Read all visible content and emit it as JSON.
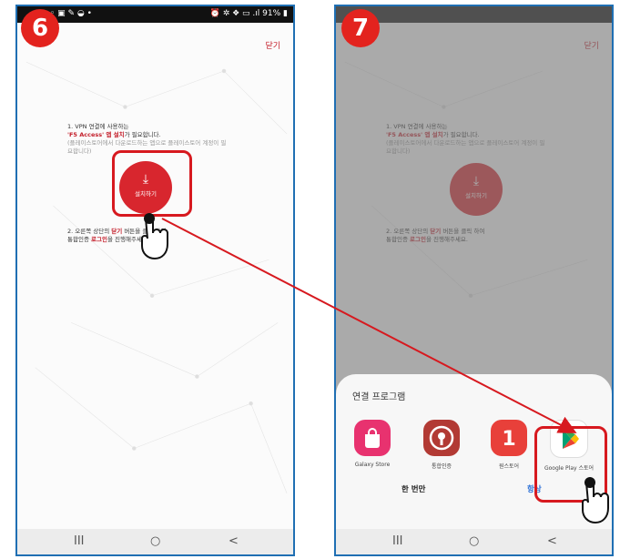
{
  "steps": {
    "left_number": "6",
    "right_number": "7"
  },
  "status_bar": {
    "battery": "91%"
  },
  "screen": {
    "close_label": "닫기",
    "step1_line1": "1. VPN 연결에 사용하는",
    "step1_app": "'F5 Access' 앱 설치",
    "step1_line2_suffix": "가 필요합니다.",
    "step1_note_line1": "(플레이스토어에서 다운로드하는 앱으로 플레이스토어 계정이 필",
    "step1_note_line2": "요합니다)",
    "install_label": "설치하기",
    "step2_prefix": "2. 오른쪽 상단의 ",
    "step2_close": "닫기",
    "step2_suffix": " 버튼을 클릭 하여",
    "step2_line2_prefix": "통합인증 ",
    "step2_login": "로그인",
    "step2_line2_suffix": "을 진행해주세요."
  },
  "sheet": {
    "title": "연결 프로그램",
    "apps": [
      {
        "label": "Galaxy Store",
        "icon": "galaxy-store-icon",
        "color": "#e8326f"
      },
      {
        "label": "통합인증",
        "icon": "auth-icon",
        "color": "#b23a34"
      },
      {
        "label": "원스토어",
        "icon": "onestore-icon",
        "color": "#e8403a"
      },
      {
        "label": "Google Play 스토어",
        "icon": "google-play-icon",
        "color": "#ffffff"
      }
    ],
    "once_label": "한 번만",
    "always_label": "항상"
  },
  "nav": {
    "recent": "III",
    "home": "○",
    "back": "<"
  },
  "colors": {
    "accent": "#d8262e",
    "highlight": "#d7191f",
    "badge": "#e3231e",
    "link_blue": "#2a6fd6"
  }
}
